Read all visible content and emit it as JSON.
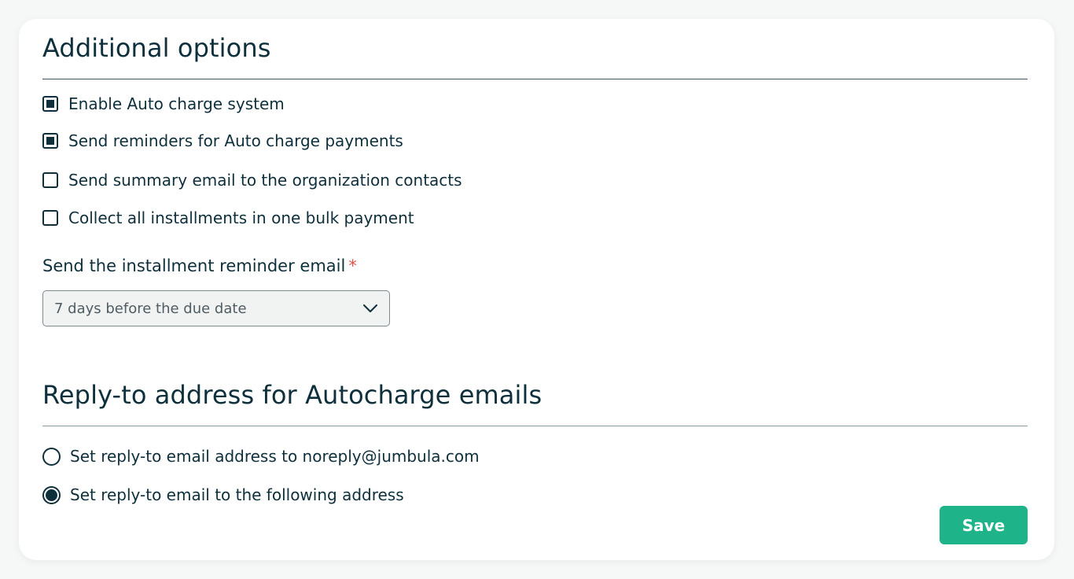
{
  "additional_options": {
    "title": "Additional options",
    "checkboxes": [
      {
        "label": "Enable Auto charge system",
        "checked": true
      },
      {
        "label": "Send reminders for Auto charge payments",
        "checked": true
      },
      {
        "label": "Send summary email to the organization contacts",
        "checked": false
      },
      {
        "label": "Collect all installments in one bulk payment",
        "checked": false
      }
    ],
    "reminder_field": {
      "label": "Send the installment reminder email",
      "required_marker": "*",
      "selected_value": "7 days before the due date",
      "icon": "chevron-down-icon"
    }
  },
  "reply_to": {
    "title": "Reply-to address for Autocharge emails",
    "radios": [
      {
        "label": "Set reply-to email address to noreply@jumbula.com",
        "checked": false
      },
      {
        "label": "Set reply-to email to the following address",
        "checked": true
      }
    ]
  },
  "actions": {
    "save_label": "Save"
  },
  "colors": {
    "text": "#0e2f3c",
    "accent": "#1fb38a",
    "required": "#e0524b"
  }
}
